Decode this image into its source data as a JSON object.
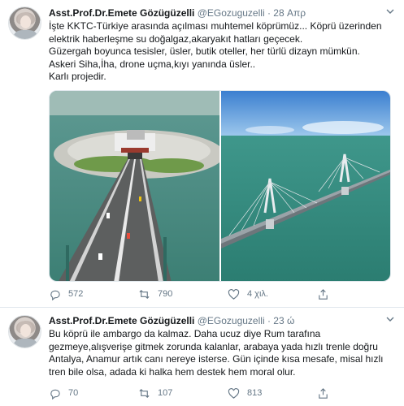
{
  "tweets": [
    {
      "name": "Asst.Prof.Dr.Emete Gözügüzelli",
      "handle": "@EGozuguzelli",
      "separator": "·",
      "time": "28 Απρ",
      "lines": [
        "İşte KKTC-Türkiye arasında açılması muhtemel köprümüz... Köprü üzerinden",
        "elektrik haberleşme su doğalgaz,akaryakıt hatları geçecek.",
        "Güzergah boyunca tesisler, üsler, butik oteller, her türlü dizayn mümkün.",
        "Askeri Siha,İha, drone uçma,kıyı yanında üsler..",
        "Karlı projedir."
      ],
      "replies": "572",
      "retweets": "790",
      "likes": "4 χιλ."
    },
    {
      "name": "Asst.Prof.Dr.Emete Gözügüzelli",
      "handle": "@EGozuguzelli",
      "separator": "·",
      "time": "23 ώ",
      "lines": [
        "Bu köprü ile ambargo da kalmaz. Daha ucuz diye Rum tarafına gezmeye,alışverişe gitmek zorunda kalanlar, arabaya yada hızlı trenle doğru Antalya, Anamur artık canı nereye isterse. Gün içinde kısa mesafe, misal hızlı tren bile olsa, adada ki halka hem destek hem moral olur."
      ],
      "replies": "70",
      "retweets": "107",
      "likes": "813"
    }
  ],
  "icons": {
    "reply": "reply-icon",
    "retweet": "retweet-icon",
    "like": "heart-icon",
    "share": "share-icon",
    "menu": "chevron-down-icon"
  },
  "colors": {
    "text": "#14171a",
    "secondary": "#657786",
    "divider": "#e1e8ed",
    "sea": "#3f8f85",
    "sky": "#4a8fd6"
  }
}
